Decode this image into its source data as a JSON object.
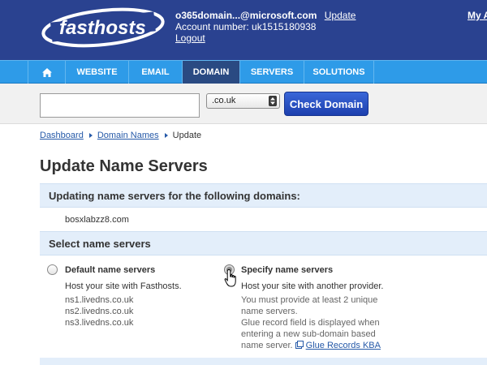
{
  "header": {
    "logo_text": "fasthosts",
    "email": "o365domain...@microsoft.com",
    "update_link": "Update",
    "account_line": "Account number: uk1515180938",
    "logout_link": "Logout",
    "my_account": "My A"
  },
  "nav": {
    "items": [
      {
        "label": "WEBSITE"
      },
      {
        "label": "EMAIL"
      },
      {
        "label": "DOMAIN"
      },
      {
        "label": "SERVERS"
      },
      {
        "label": "SOLUTIONS"
      }
    ],
    "active": "DOMAIN",
    "icons": {
      "home": "home-icon"
    }
  },
  "search": {
    "input_value": "",
    "tld_selected": ".co.uk",
    "button_label": "Check Domain"
  },
  "breadcrumb": {
    "items": [
      "Dashboard",
      "Domain Names",
      "Update"
    ]
  },
  "page": {
    "title": "Update Name Servers",
    "section1_heading": "Updating name servers for the following domains:",
    "domain": "bosxlabzz8.com",
    "section2_heading": "Select name servers"
  },
  "options": {
    "default": {
      "label": "Default name servers",
      "desc": "Host your site with Fasthosts.",
      "servers": [
        "ns1.livedns.co.uk",
        "ns2.livedns.co.uk",
        "ns3.livedns.co.uk"
      ],
      "checked": false
    },
    "specify": {
      "label": "Specify name servers",
      "desc": "Host your site with another provider.",
      "notes": [
        "You must provide at least 2 unique",
        "name servers.",
        "Glue record field is displayed when",
        "entering a new sub-domain based"
      ],
      "note_last_prefix": "name server.",
      "kba_link": "Glue Records KBA",
      "checked": true
    }
  },
  "colors": {
    "header_bg": "#2a4290",
    "nav_bg": "#2e9be8",
    "nav_active_bg": "#2a4a82",
    "button_bg": "#1c3fae",
    "section_bg": "#e3eefa",
    "link": "#2559a8"
  }
}
